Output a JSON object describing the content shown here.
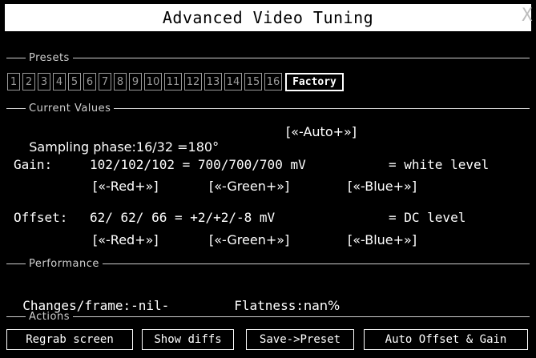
{
  "title": "Advanced Video Tuning",
  "close_glyph": "X",
  "sections": {
    "presets": "Presets",
    "current": "Current Values",
    "performance": "Performance",
    "actions": "Actions"
  },
  "presets": [
    "1",
    "2",
    "3",
    "4",
    "5",
    "6",
    "7",
    "8",
    "9",
    "10",
    "11",
    "12",
    "13",
    "14",
    "15",
    "16"
  ],
  "factory_label": "Factory",
  "sampling": {
    "label": "Sampling phase:",
    "value": "16/32 =180°",
    "control": "[«-Auto+»]"
  },
  "gain": {
    "label": "Gain:",
    "value": "102/102/102 = 700/700/700 mV",
    "suffix": "= white level",
    "red": "[«-Red+»]",
    "green": "[«-Green+»]",
    "blue": "[«-Blue+»]"
  },
  "offset": {
    "label": "Offset:",
    "value": "62/ 62/ 66 = +2/+2/-8 mV",
    "suffix": "= DC level",
    "red": "[«-Red+»]",
    "green": "[«-Green+»]",
    "blue": "[«-Blue+»]"
  },
  "performance": {
    "changes_label": "Changes/frame:",
    "changes_value": "-nil-",
    "flatness_label": "Flatness:",
    "flatness_value": "nan%"
  },
  "actions": {
    "regrab": "Regrab screen",
    "diffs": "Show diffs",
    "save": "Save->Preset",
    "auto": "Auto Offset & Gain"
  }
}
